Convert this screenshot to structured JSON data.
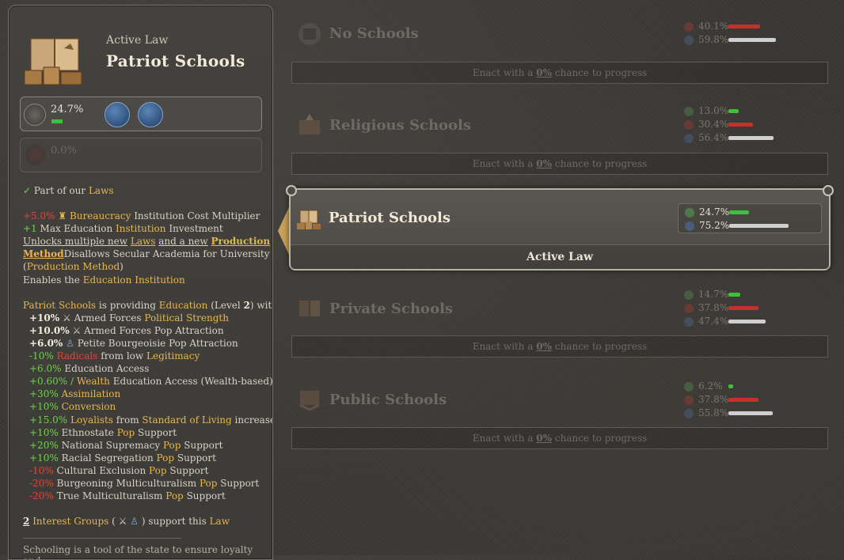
{
  "left_panel": {
    "subtitle": "Active Law",
    "title": "Patriot Schools",
    "support_pct": "24.7%",
    "oppose_pct": "0.0%",
    "part_of_prefix": "Part of our",
    "part_of_link": "Laws",
    "effects": {
      "e1_val": "+5.0%",
      "e1_link": "Bureaucracy",
      "e1_txt1": "Institution",
      "e1_txt2": "Cost Multiplier",
      "e2_val": "+1",
      "e2_txt1": "Max Education",
      "e2_link": "Institution",
      "e2_txt2": "Investment",
      "unlocks_txt1": "Unlocks multiple new",
      "unlocks_link1": "Laws",
      "unlocks_txt2": "and a new",
      "unlocks_link2": "Production",
      "unlocks_link3": "Method",
      "disallows_txt1": "Disallows",
      "disallows_txt2": "Secular Academia",
      "disallows_txt3": "for",
      "disallows_txt4": "University",
      "disallows_link": "Production Method",
      "enables_txt": "Enables the",
      "enables_link": "Education",
      "enables_link2": "Institution"
    },
    "providing": {
      "law": "Patriot Schools",
      "txt1": "is providing",
      "inst": "Education",
      "level_txt": "(Level",
      "level": "2",
      "with": ") with:"
    },
    "modifiers": [
      {
        "val": "+10%",
        "icon": "⚔",
        "a": "Armed Forces",
        "b": "Political Strength"
      },
      {
        "val": "+10.0%",
        "icon": "⚔",
        "a": "Armed Forces Pop Attraction",
        "b": ""
      },
      {
        "val": "+6.0%",
        "icon": "♙",
        "a": "Petite Bourgeoisie Pop Attraction",
        "b": ""
      }
    ],
    "green_lines": [
      {
        "val": "-10%",
        "red": "Radicals",
        "txt": "from low",
        "gold": "Legitimacy"
      },
      {
        "val": "+6.0%",
        "txt": "Education Access"
      },
      {
        "val": "+0.60% /",
        "gold": "Wealth",
        "txt": "Education Access (Wealth-based)"
      },
      {
        "val": "+30%",
        "gold": "Assimilation"
      },
      {
        "val": "+10%",
        "gold": "Conversion"
      },
      {
        "val": "+15.0%",
        "gold": "Loyalists",
        "txt": "from",
        "gold2": "Standard of Living",
        "txt2": "increases"
      },
      {
        "val": "+10%",
        "txt": "Ethnostate",
        "gold": "Pop",
        "txt2": "Support"
      },
      {
        "val": "+20%",
        "txt": "National Supremacy",
        "gold": "Pop",
        "txt2": "Support"
      },
      {
        "val": "+10%",
        "txt": "Racial Segregation",
        "gold": "Pop",
        "txt2": "Support"
      },
      {
        "val": "-10%",
        "txt": "Cultural Exclusion",
        "gold": "Pop",
        "txt2": "Support"
      },
      {
        "val": "-20%",
        "txt": "Burgeoning Multiculturalism",
        "gold": "Pop",
        "txt2": "Support"
      },
      {
        "val": "-20%",
        "txt": "True Multiculturalism",
        "gold": "Pop",
        "txt2": "Support"
      }
    ],
    "interest": {
      "count": "2",
      "link": "Interest Groups",
      "open": "(",
      "close": ") support this",
      "law": "Law"
    },
    "description": "Schooling is a tool of the state to ensure loyalty and"
  },
  "laws": [
    {
      "name": "No Schools",
      "enact_prefix": "Enact with a",
      "enact_pct": "0%",
      "enact_suffix": "chance to progress",
      "stats": [
        {
          "type": "oppose",
          "val": "40.1%",
          "frac": 0.401
        },
        {
          "type": "neutral",
          "val": "59.8%",
          "frac": 0.598
        }
      ]
    },
    {
      "name": "Religious Schools",
      "enact_prefix": "Enact with a",
      "enact_pct": "0%",
      "enact_suffix": "chance to progress",
      "stats": [
        {
          "type": "support",
          "val": "13.0%",
          "frac": 0.13
        },
        {
          "type": "oppose",
          "val": "30.4%",
          "frac": 0.304
        },
        {
          "type": "neutral",
          "val": "56.4%",
          "frac": 0.564
        }
      ]
    },
    {
      "name": "Private Schools",
      "enact_prefix": "Enact with a",
      "enact_pct": "0%",
      "enact_suffix": "chance to progress",
      "stats": [
        {
          "type": "support",
          "val": "14.7%",
          "frac": 0.147
        },
        {
          "type": "oppose",
          "val": "37.8%",
          "frac": 0.378
        },
        {
          "type": "neutral",
          "val": "47.4%",
          "frac": 0.474
        }
      ]
    },
    {
      "name": "Public Schools",
      "enact_prefix": "Enact with a",
      "enact_pct": "0%",
      "enact_suffix": "chance to progress",
      "stats": [
        {
          "type": "support",
          "val": "6.2%",
          "frac": 0.062
        },
        {
          "type": "oppose",
          "val": "37.8%",
          "frac": 0.378
        },
        {
          "type": "neutral",
          "val": "55.8%",
          "frac": 0.558
        }
      ]
    }
  ],
  "active_law": {
    "name": "Patriot Schools",
    "footer": "Active Law",
    "stats": [
      {
        "type": "support",
        "val": "24.7%",
        "frac": 0.247
      },
      {
        "type": "neutral",
        "val": "75.2%",
        "frac": 0.752
      }
    ]
  },
  "colors": {
    "support": "#3fbf3a",
    "oppose": "#c8312b",
    "neutral": "#cfcfcf",
    "gold": "#e7b64f"
  }
}
